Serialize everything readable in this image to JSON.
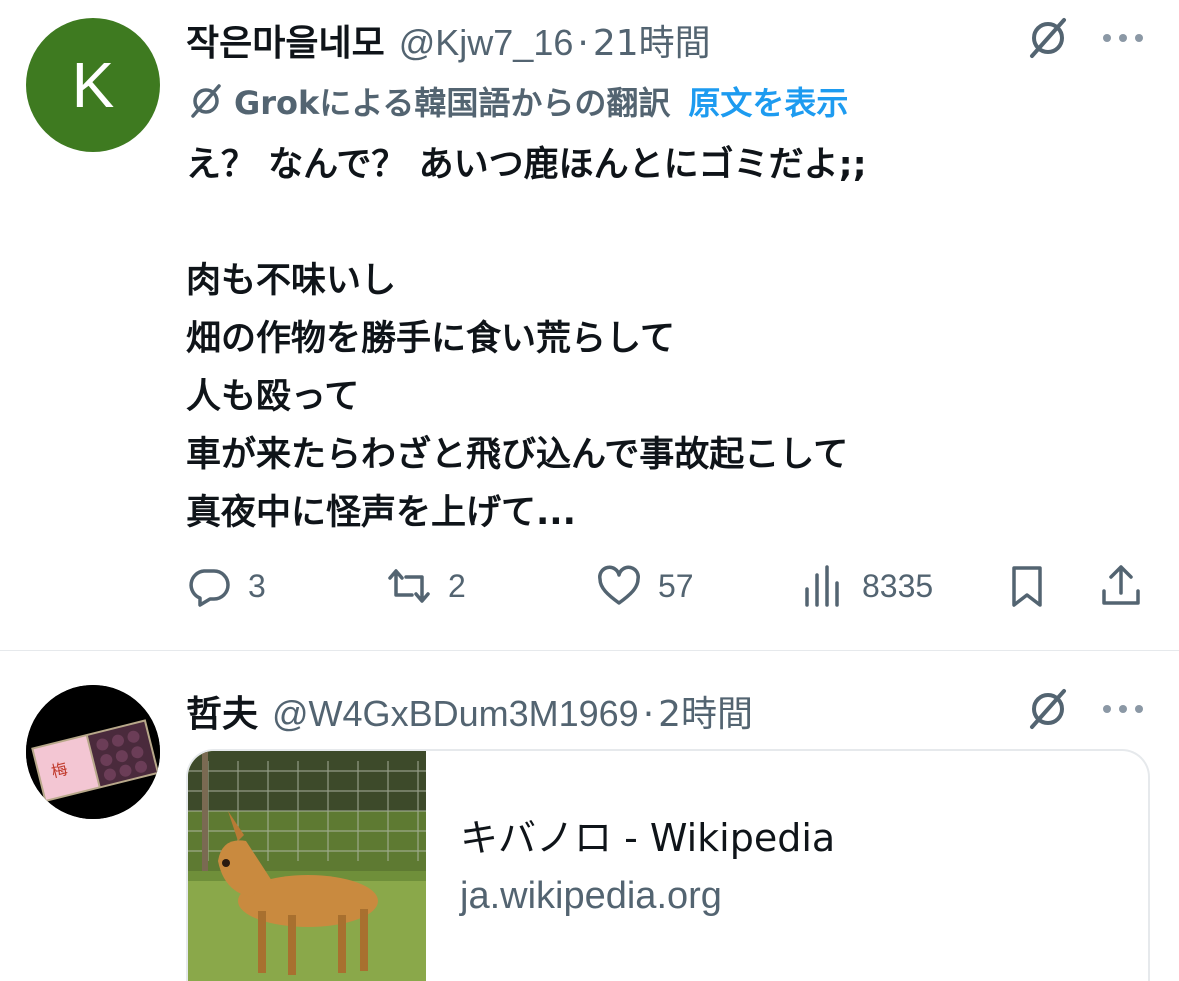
{
  "tweets": [
    {
      "avatar_letter": "K",
      "display_name": "작은마을네모",
      "handle": "@Kjw7_16",
      "separator": "·",
      "time": "21時間",
      "translation_label": "Grokによる韓国語からの翻訳",
      "translation_link": "原文を表示",
      "lines": [
        "え？ なんで？ あいつ鹿ほんとにゴミだよ;;",
        "",
        "肉も不味いし",
        "畑の作物を勝手に食い荒らして",
        "人も殴って",
        "車が来たらわざと飛び込んで事故起こして",
        "真夜中に怪声を上げて..."
      ],
      "stats": {
        "replies": "3",
        "reposts": "2",
        "likes": "57",
        "views": "8335"
      }
    },
    {
      "display_name": "哲夫",
      "handle": "@W4GxBDum3M1969",
      "separator": "·",
      "time": "2時間",
      "card": {
        "title": "キバノロ - Wikipedia",
        "domain": "ja.wikipedia.org"
      }
    }
  ],
  "colors": {
    "text": "#0f1419",
    "muted": "#536471",
    "link": "#1d9bf0",
    "avatar1": "#3e7a20",
    "divider": "#e6e9ec"
  },
  "icons": [
    "grok-slash-icon",
    "more-icon",
    "reply-icon",
    "repost-icon",
    "like-icon",
    "views-icon",
    "bookmark-icon",
    "share-icon"
  ]
}
